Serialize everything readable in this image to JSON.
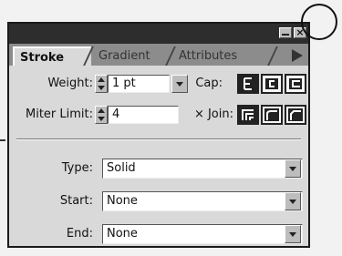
{
  "tabs": [
    {
      "label": "Stroke",
      "active": true
    },
    {
      "label": "Gradient",
      "active": false
    },
    {
      "label": "Attributes",
      "active": false
    }
  ],
  "weight": {
    "label": "Weight:",
    "value": "1 pt"
  },
  "cap": {
    "label": "Cap:",
    "options": [
      "butt-cap-icon",
      "round-cap-icon",
      "projecting-cap-icon"
    ]
  },
  "miter_limit": {
    "label": "Miter Limit:",
    "value": "4"
  },
  "join": {
    "label": "× Join:",
    "options": [
      "miter-join-icon",
      "round-join-icon",
      "bevel-join-icon"
    ]
  },
  "type": {
    "label": "Type:",
    "value": "Solid"
  },
  "start": {
    "label": "Start:",
    "value": "None"
  },
  "end": {
    "label": "End:",
    "value": "None"
  },
  "colors": {
    "panel": "#d9d9d9",
    "titlebar": "#2d2d2d",
    "tabstrip": "#8c8c8c"
  }
}
